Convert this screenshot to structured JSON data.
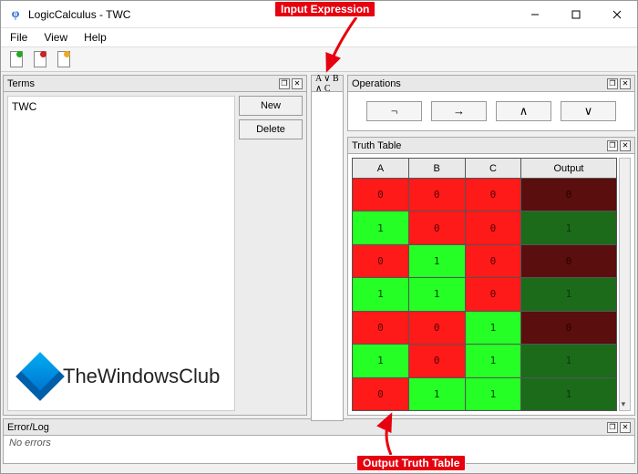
{
  "window": {
    "title": "LogicCalculus - TWC"
  },
  "menu": {
    "file": "File",
    "view": "View",
    "help": "Help"
  },
  "panels": {
    "terms": "Terms",
    "operations": "Operations",
    "truth_table": "Truth Table",
    "error": "Error/Log"
  },
  "terms": {
    "items": [
      "TWC"
    ],
    "new_btn": "New",
    "delete_btn": "Delete"
  },
  "expression": {
    "text": "A ∨ B ∧ C"
  },
  "operations": {
    "not": "¬",
    "implies": "→",
    "and": "∧",
    "or": "∨"
  },
  "truth_table": {
    "headers": [
      "A",
      "B",
      "C",
      "Output"
    ],
    "rows": [
      {
        "a": 0,
        "b": 0,
        "c": 0,
        "out": 0
      },
      {
        "a": 1,
        "b": 0,
        "c": 0,
        "out": 1
      },
      {
        "a": 0,
        "b": 1,
        "c": 0,
        "out": 0
      },
      {
        "a": 1,
        "b": 1,
        "c": 0,
        "out": 1
      },
      {
        "a": 0,
        "b": 0,
        "c": 1,
        "out": 0
      },
      {
        "a": 1,
        "b": 0,
        "c": 1,
        "out": 1
      },
      {
        "a": 0,
        "b": 1,
        "c": 1,
        "out": 1
      }
    ],
    "colors": {
      "cell_true": "#25ff25",
      "cell_false": "#ff1a1a",
      "out_true": "#1b6b1b",
      "out_false": "#5a0e0e"
    }
  },
  "errors": {
    "text": "No errors"
  },
  "logo": {
    "text": "TheWindowsClub"
  },
  "annotations": {
    "input": "Input Expression",
    "output": "Output Truth Table"
  }
}
